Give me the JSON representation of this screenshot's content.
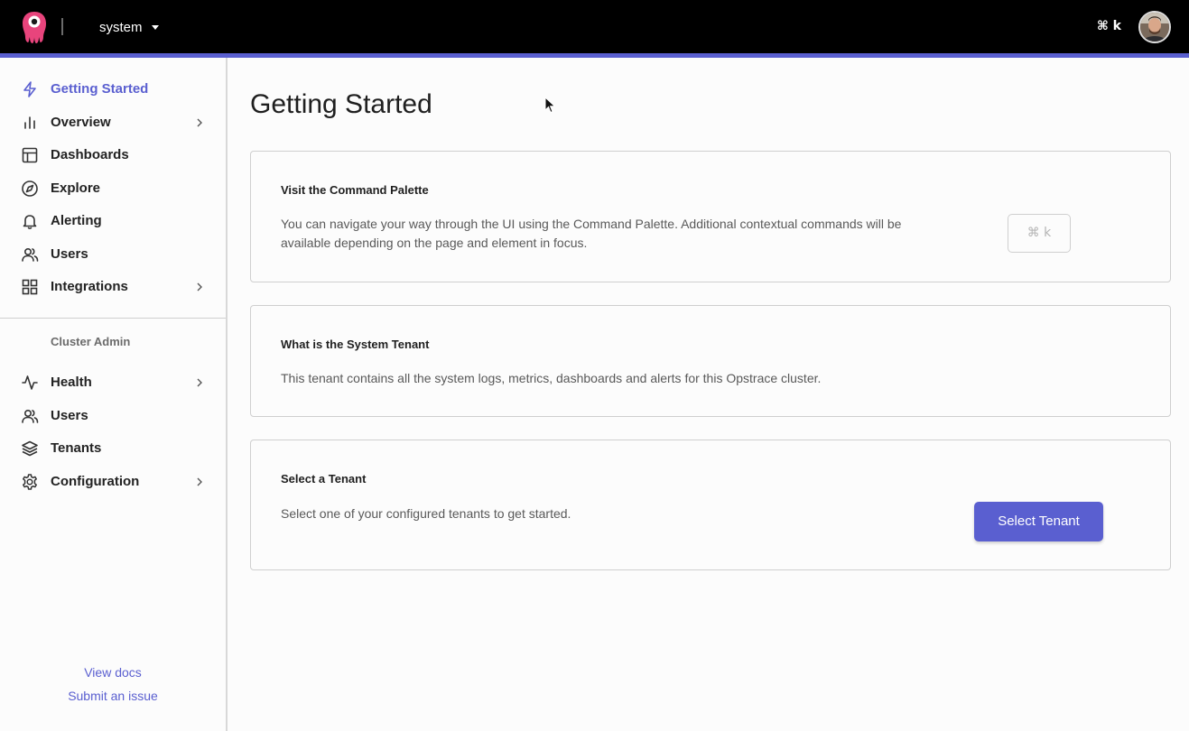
{
  "colors": {
    "accent": "#5a5fd0",
    "topbar": "#000000"
  },
  "topbar": {
    "tenant": "system",
    "command_shortcut": "⌘ k"
  },
  "sidebar": {
    "items": [
      {
        "label": "Getting Started",
        "icon": "lightning-icon",
        "active": true
      },
      {
        "label": "Overview",
        "icon": "bar-chart-icon",
        "has_chevron": true
      },
      {
        "label": "Dashboards",
        "icon": "dashboard-layout-icon"
      },
      {
        "label": "Explore",
        "icon": "compass-icon"
      },
      {
        "label": "Alerting",
        "icon": "bell-icon"
      },
      {
        "label": "Users",
        "icon": "users-icon"
      },
      {
        "label": "Integrations",
        "icon": "grid-icon",
        "has_chevron": true
      }
    ],
    "section_label": "Cluster Admin",
    "admin_items": [
      {
        "label": "Health",
        "icon": "activity-icon",
        "has_chevron": true
      },
      {
        "label": "Users",
        "icon": "users-icon"
      },
      {
        "label": "Tenants",
        "icon": "layers-icon"
      },
      {
        "label": "Configuration",
        "icon": "gear-icon",
        "has_chevron": true
      }
    ],
    "links": {
      "docs": "View docs",
      "issue": "Submit an issue"
    }
  },
  "main": {
    "title": "Getting Started",
    "cards": [
      {
        "title": "Visit the Command Palette",
        "text": "You can navigate your way through the UI using the Command Palette. Additional contextual commands will be available depending on the page and element in focus.",
        "button": "⌘ k"
      },
      {
        "title": "What is the System Tenant",
        "text": "This tenant contains all the system logs, metrics, dashboards and alerts for this Opstrace cluster."
      },
      {
        "title": "Select a Tenant",
        "text": "Select one of your configured tenants to get started.",
        "button": "Select Tenant"
      }
    ]
  }
}
